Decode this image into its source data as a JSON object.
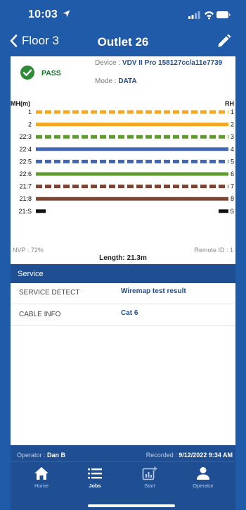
{
  "status": {
    "time": "10:03"
  },
  "nav": {
    "back_label": "Floor 3",
    "title": "Outlet 26"
  },
  "summary": {
    "result": "PASS",
    "device_label": "Device :",
    "device_value": "VDV II Pro 158127cc/a11e7739",
    "mode_label": "Mode :",
    "mode_value": "DATA"
  },
  "wiremap": {
    "left_header": "MH(m)",
    "right_header": "RH",
    "length": "Length: 21.3m",
    "wires": [
      {
        "left": "1",
        "right": "1",
        "color": "#F5A623",
        "dashed": true
      },
      {
        "left": "2",
        "right": "2",
        "color": "#F5A623",
        "dashed": false
      },
      {
        "left": "22:3",
        "right": "3",
        "color": "#5E9B2E",
        "dashed": true
      },
      {
        "left": "22:4",
        "right": "4",
        "color": "#3E67B8",
        "dashed": false
      },
      {
        "left": "22:5",
        "right": "5",
        "color": "#3E67B8",
        "dashed": true
      },
      {
        "left": "22:6",
        "right": "6",
        "color": "#5E9B2E",
        "dashed": false
      },
      {
        "left": "21:7",
        "right": "7",
        "color": "#7A4431",
        "dashed": true
      },
      {
        "left": "21:8",
        "right": "8",
        "color": "#7A4431",
        "dashed": false
      },
      {
        "left": "21:S",
        "right": "S",
        "color": "#111111",
        "dashed": false,
        "shield": true
      }
    ],
    "nvp": "NVP : 72%",
    "remote_id": "Remote ID : 1"
  },
  "service": {
    "header": "Service",
    "rows": [
      {
        "label": "SERVICE DETECT",
        "value": "Wiremap test result"
      },
      {
        "label": "CABLE INFO",
        "value": "Cat 6"
      }
    ]
  },
  "footer": {
    "operator_label": "Operator :",
    "operator_value": "Dan B",
    "recorded_label": "Recorded :",
    "recorded_value": "9/12/2022 9:34 AM"
  },
  "tabs": [
    {
      "label": "Home",
      "icon": "home-icon"
    },
    {
      "label": "Jobs",
      "icon": "list-icon"
    },
    {
      "label": "Start",
      "icon": "chart-add-icon"
    },
    {
      "label": "Operator",
      "icon": "person-icon"
    }
  ],
  "colors": {
    "brand_blue": "#1F5BA8",
    "panel_blue": "#1F4E93",
    "pass_green": "#1a6e2a"
  }
}
